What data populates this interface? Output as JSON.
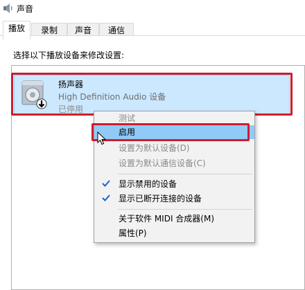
{
  "window": {
    "title": "声音"
  },
  "tabs": [
    {
      "label": "播放",
      "active": true
    },
    {
      "label": "录制",
      "active": false
    },
    {
      "label": "声音",
      "active": false
    },
    {
      "label": "通信",
      "active": false
    }
  ],
  "instruction": "选择以下播放设备来修改设置:",
  "device": {
    "icon": "speaker-icon",
    "name": "扬声器",
    "description": "High Definition Audio 设备",
    "status": "已停用"
  },
  "context_menu": {
    "items": [
      {
        "label": "测试",
        "enabled": false,
        "checked": false,
        "highlighted": false
      },
      {
        "label": "启用",
        "enabled": true,
        "checked": false,
        "highlighted": true
      },
      {
        "label": "设置为默认设备(D)",
        "enabled": false,
        "checked": false,
        "highlighted": false
      },
      {
        "label": "设置为默认通信设备(C)",
        "enabled": false,
        "checked": false,
        "highlighted": false
      },
      {
        "label": "显示禁用的设备",
        "enabled": true,
        "checked": true,
        "highlighted": false
      },
      {
        "label": "显示已断开连接的设备",
        "enabled": true,
        "checked": true,
        "highlighted": false
      },
      {
        "label": "关于软件 MIDI 合成器(M)",
        "enabled": true,
        "checked": false,
        "highlighted": false
      },
      {
        "label": "属性(P)",
        "enabled": true,
        "checked": false,
        "highlighted": false
      }
    ]
  },
  "colors": {
    "selection_bg": "#cce8ff",
    "menu_hover": "#91c9f7",
    "annotation_red": "#cc1d2c",
    "check_blue": "#1a62c8"
  }
}
